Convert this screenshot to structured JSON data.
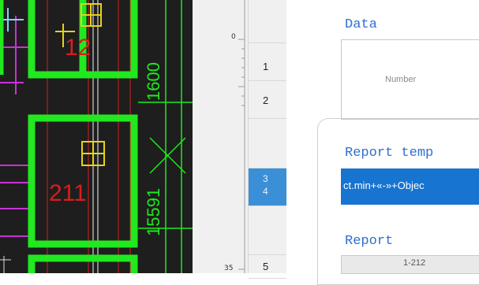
{
  "cad": {
    "labels": [
      "12",
      "211",
      "1600",
      "15591"
    ]
  },
  "ruler": {
    "top_label": "0",
    "bottom_label": "35"
  },
  "rows": [
    {
      "label": "1",
      "selected": false
    },
    {
      "label": "2",
      "selected": false
    },
    {
      "label": "3",
      "selected": true
    },
    {
      "label": "4",
      "selected": true
    },
    {
      "label": "5",
      "selected": false
    }
  ],
  "panel": {
    "data_heading": "Data",
    "number_label": "Number",
    "report_template_heading": "Report temp",
    "report_template_value": "ct.min+«-»+Objec",
    "report_heading": "Report",
    "report_value": "1-212"
  },
  "colors": {
    "selection_blue": "#1774d0",
    "heading_blue": "#2e6fd0",
    "cad_green": "#21e81f",
    "cad_yellow": "#e6d21a",
    "cad_red": "#d81e1e",
    "cad_magenta": "#c832d8"
  }
}
